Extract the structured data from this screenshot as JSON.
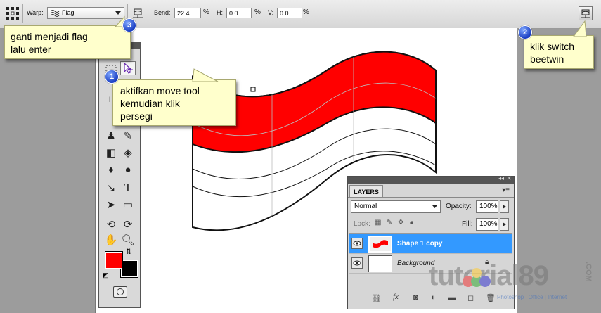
{
  "options_bar": {
    "warp_label": "Warp:",
    "warp_value": "Flag",
    "bend_label": "Bend:",
    "bend_value": "22.4",
    "bend_unit": "%",
    "h_label": "H:",
    "h_value": "0.0",
    "h_unit": "%",
    "v_label": "V:",
    "v_value": "0.0",
    "v_unit": "%"
  },
  "callouts": {
    "c3": {
      "badge": "3",
      "line1": "ganti menjadi flag",
      "line2": "lalu enter"
    },
    "c1": {
      "badge": "1",
      "line1": "aktifkan move tool",
      "line2": "kemudian klik",
      "line3": "persegi"
    },
    "c2": {
      "badge": "2",
      "line1": "klik switch",
      "line2": "beetwin"
    }
  },
  "layers_panel": {
    "tab_label": "LAYERS",
    "blend_mode": "Normal",
    "opacity_label": "Opacity:",
    "opacity_value": "100%",
    "lock_label": "Lock:",
    "fill_label": "Fill:",
    "fill_value": "100%",
    "layers": [
      {
        "name": "Shape 1 copy",
        "selected": true
      },
      {
        "name": "Background",
        "selected": false
      }
    ]
  },
  "watermark": {
    "text": "tutorial89",
    "com": ".COM",
    "sub": "Photoshop | Office | Internet"
  },
  "colors": {
    "flag_red": "#ff0000",
    "selection_blue": "#3399ff",
    "callout_bg": "#ffffcc",
    "foreground_color": "#ff0000",
    "background_color": "#000000"
  }
}
